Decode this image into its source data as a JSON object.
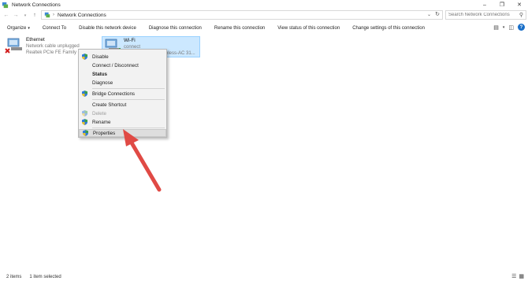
{
  "window": {
    "title": "Network Connections"
  },
  "address": {
    "breadcrumb": "Network Connections",
    "search_placeholder": "Search Network Connections"
  },
  "commandbar": {
    "organize": "Organize",
    "connect_to": "Connect To",
    "disable_device": "Disable this network device",
    "diagnose": "Diagnose this connection",
    "rename": "Rename this connection",
    "view_status": "View status of this connection",
    "change_settings": "Change settings of this connection"
  },
  "items": {
    "ethernet": {
      "name": "Ethernet",
      "status": "Network cable unplugged",
      "adapter": "Realtek PCIe FE Family C"
    },
    "wifi": {
      "name": "Wi-Fi",
      "status": "connect",
      "adapter": "Wireless-AC 31..."
    }
  },
  "context_menu": {
    "items": [
      {
        "label": "Disable",
        "shield": true
      },
      {
        "label": "Connect / Disconnect",
        "shield": false
      },
      {
        "label": "Status",
        "shield": false,
        "bold": true
      },
      {
        "label": "Diagnose",
        "shield": false
      },
      {
        "label": "Bridge Connections",
        "shield": true
      },
      {
        "label": "Create Shortcut",
        "shield": false
      },
      {
        "label": "Delete",
        "shield": true,
        "disabled": true
      },
      {
        "label": "Rename",
        "shield": true
      },
      {
        "label": "Properties",
        "shield": true,
        "highlighted": true
      }
    ]
  },
  "statusbar": {
    "count": "2 items",
    "selected": "1 item selected"
  },
  "colors": {
    "selection_bg": "#cce8ff",
    "selection_border": "#99d1ff",
    "arrow": "#e04a45",
    "shield_blue": "#2f7ad9",
    "shield_green": "#3aa04a"
  }
}
